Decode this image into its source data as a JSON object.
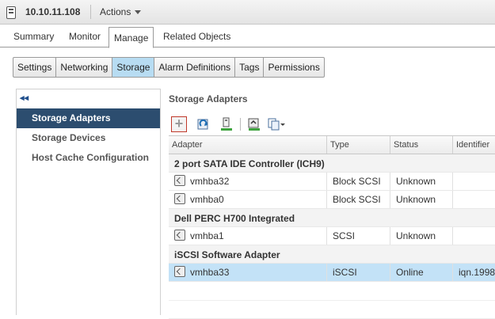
{
  "header": {
    "hostname": "10.10.11.108",
    "actions_label": "Actions"
  },
  "tabs": [
    {
      "label": "Summary"
    },
    {
      "label": "Monitor"
    },
    {
      "label": "Manage",
      "active": true
    },
    {
      "label": "Related Objects"
    }
  ],
  "subtabs": [
    {
      "label": "Settings"
    },
    {
      "label": "Networking"
    },
    {
      "label": "Storage",
      "active": true
    },
    {
      "label": "Alarm Definitions"
    },
    {
      "label": "Tags"
    },
    {
      "label": "Permissions"
    }
  ],
  "nav": {
    "collapse_glyph": "◂◂",
    "items": [
      {
        "label": "Storage Adapters",
        "active": true
      },
      {
        "label": "Storage Devices"
      },
      {
        "label": "Host Cache Configuration"
      }
    ]
  },
  "main": {
    "title": "Storage Adapters",
    "toolbar": {
      "add_glyph": "+"
    },
    "columns": [
      "Adapter",
      "Type",
      "Status",
      "Identifier"
    ],
    "groups": [
      {
        "name": "2 port SATA IDE Controller (ICH9)",
        "rows": [
          {
            "adapter": "vmhba32",
            "type": "Block SCSI",
            "status": "Unknown",
            "identifier": ""
          },
          {
            "adapter": "vmhba0",
            "type": "Block SCSI",
            "status": "Unknown",
            "identifier": ""
          }
        ]
      },
      {
        "name": "Dell PERC H700 Integrated",
        "rows": [
          {
            "adapter": "vmhba1",
            "type": "SCSI",
            "status": "Unknown",
            "identifier": ""
          }
        ]
      },
      {
        "name": "iSCSI Software Adapter",
        "rows": [
          {
            "adapter": "vmhba33",
            "type": "iSCSI",
            "status": "Online",
            "identifier": "iqn.1998",
            "selected": true
          }
        ]
      }
    ]
  },
  "colors": {
    "accent": "#2c4d6f",
    "selection": "#c3e2f7",
    "add_highlight": "#c0392b"
  }
}
